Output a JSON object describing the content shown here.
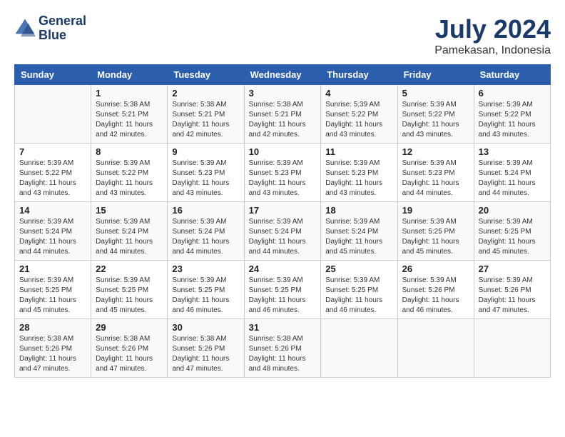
{
  "header": {
    "logo_line1": "General",
    "logo_line2": "Blue",
    "month_year": "July 2024",
    "location": "Pamekasan, Indonesia"
  },
  "weekdays": [
    "Sunday",
    "Monday",
    "Tuesday",
    "Wednesday",
    "Thursday",
    "Friday",
    "Saturday"
  ],
  "weeks": [
    [
      {
        "day": "",
        "info": ""
      },
      {
        "day": "1",
        "info": "Sunrise: 5:38 AM\nSunset: 5:21 PM\nDaylight: 11 hours\nand 42 minutes."
      },
      {
        "day": "2",
        "info": "Sunrise: 5:38 AM\nSunset: 5:21 PM\nDaylight: 11 hours\nand 42 minutes."
      },
      {
        "day": "3",
        "info": "Sunrise: 5:38 AM\nSunset: 5:21 PM\nDaylight: 11 hours\nand 42 minutes."
      },
      {
        "day": "4",
        "info": "Sunrise: 5:39 AM\nSunset: 5:22 PM\nDaylight: 11 hours\nand 43 minutes."
      },
      {
        "day": "5",
        "info": "Sunrise: 5:39 AM\nSunset: 5:22 PM\nDaylight: 11 hours\nand 43 minutes."
      },
      {
        "day": "6",
        "info": "Sunrise: 5:39 AM\nSunset: 5:22 PM\nDaylight: 11 hours\nand 43 minutes."
      }
    ],
    [
      {
        "day": "7",
        "info": "Sunrise: 5:39 AM\nSunset: 5:22 PM\nDaylight: 11 hours\nand 43 minutes."
      },
      {
        "day": "8",
        "info": "Sunrise: 5:39 AM\nSunset: 5:22 PM\nDaylight: 11 hours\nand 43 minutes."
      },
      {
        "day": "9",
        "info": "Sunrise: 5:39 AM\nSunset: 5:23 PM\nDaylight: 11 hours\nand 43 minutes."
      },
      {
        "day": "10",
        "info": "Sunrise: 5:39 AM\nSunset: 5:23 PM\nDaylight: 11 hours\nand 43 minutes."
      },
      {
        "day": "11",
        "info": "Sunrise: 5:39 AM\nSunset: 5:23 PM\nDaylight: 11 hours\nand 43 minutes."
      },
      {
        "day": "12",
        "info": "Sunrise: 5:39 AM\nSunset: 5:23 PM\nDaylight: 11 hours\nand 44 minutes."
      },
      {
        "day": "13",
        "info": "Sunrise: 5:39 AM\nSunset: 5:24 PM\nDaylight: 11 hours\nand 44 minutes."
      }
    ],
    [
      {
        "day": "14",
        "info": "Sunrise: 5:39 AM\nSunset: 5:24 PM\nDaylight: 11 hours\nand 44 minutes."
      },
      {
        "day": "15",
        "info": "Sunrise: 5:39 AM\nSunset: 5:24 PM\nDaylight: 11 hours\nand 44 minutes."
      },
      {
        "day": "16",
        "info": "Sunrise: 5:39 AM\nSunset: 5:24 PM\nDaylight: 11 hours\nand 44 minutes."
      },
      {
        "day": "17",
        "info": "Sunrise: 5:39 AM\nSunset: 5:24 PM\nDaylight: 11 hours\nand 44 minutes."
      },
      {
        "day": "18",
        "info": "Sunrise: 5:39 AM\nSunset: 5:24 PM\nDaylight: 11 hours\nand 45 minutes."
      },
      {
        "day": "19",
        "info": "Sunrise: 5:39 AM\nSunset: 5:25 PM\nDaylight: 11 hours\nand 45 minutes."
      },
      {
        "day": "20",
        "info": "Sunrise: 5:39 AM\nSunset: 5:25 PM\nDaylight: 11 hours\nand 45 minutes."
      }
    ],
    [
      {
        "day": "21",
        "info": "Sunrise: 5:39 AM\nSunset: 5:25 PM\nDaylight: 11 hours\nand 45 minutes."
      },
      {
        "day": "22",
        "info": "Sunrise: 5:39 AM\nSunset: 5:25 PM\nDaylight: 11 hours\nand 45 minutes."
      },
      {
        "day": "23",
        "info": "Sunrise: 5:39 AM\nSunset: 5:25 PM\nDaylight: 11 hours\nand 46 minutes."
      },
      {
        "day": "24",
        "info": "Sunrise: 5:39 AM\nSunset: 5:25 PM\nDaylight: 11 hours\nand 46 minutes."
      },
      {
        "day": "25",
        "info": "Sunrise: 5:39 AM\nSunset: 5:25 PM\nDaylight: 11 hours\nand 46 minutes."
      },
      {
        "day": "26",
        "info": "Sunrise: 5:39 AM\nSunset: 5:26 PM\nDaylight: 11 hours\nand 46 minutes."
      },
      {
        "day": "27",
        "info": "Sunrise: 5:39 AM\nSunset: 5:26 PM\nDaylight: 11 hours\nand 47 minutes."
      }
    ],
    [
      {
        "day": "28",
        "info": "Sunrise: 5:38 AM\nSunset: 5:26 PM\nDaylight: 11 hours\nand 47 minutes."
      },
      {
        "day": "29",
        "info": "Sunrise: 5:38 AM\nSunset: 5:26 PM\nDaylight: 11 hours\nand 47 minutes."
      },
      {
        "day": "30",
        "info": "Sunrise: 5:38 AM\nSunset: 5:26 PM\nDaylight: 11 hours\nand 47 minutes."
      },
      {
        "day": "31",
        "info": "Sunrise: 5:38 AM\nSunset: 5:26 PM\nDaylight: 11 hours\nand 48 minutes."
      },
      {
        "day": "",
        "info": ""
      },
      {
        "day": "",
        "info": ""
      },
      {
        "day": "",
        "info": ""
      }
    ]
  ]
}
